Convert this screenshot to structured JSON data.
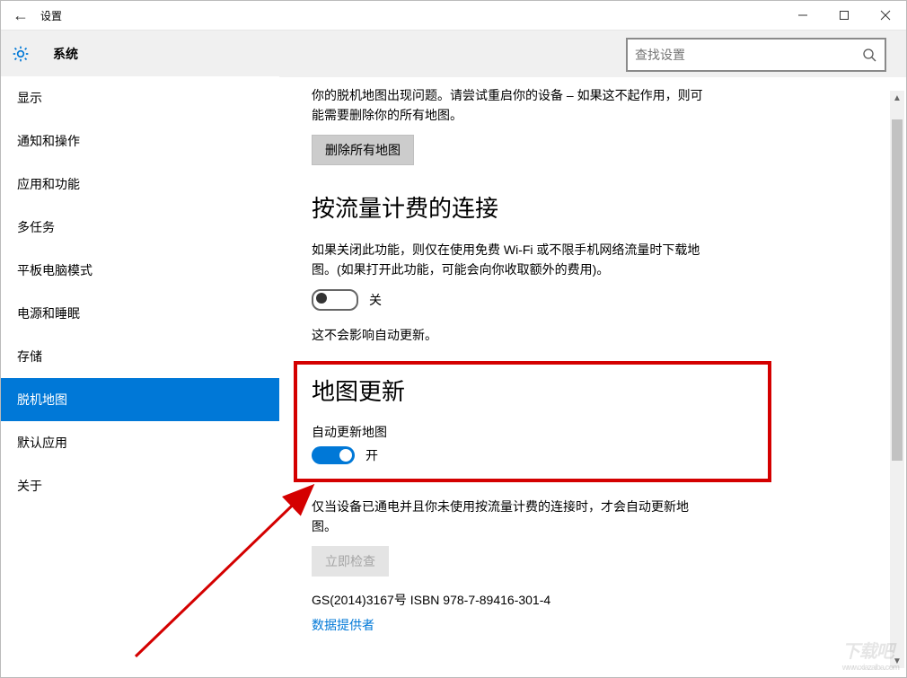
{
  "window": {
    "title": "设置"
  },
  "header": {
    "title": "系统",
    "search_placeholder": "查找设置"
  },
  "sidebar": {
    "items": [
      {
        "label": "显示"
      },
      {
        "label": "通知和操作"
      },
      {
        "label": "应用和功能"
      },
      {
        "label": "多任务"
      },
      {
        "label": "平板电脑模式"
      },
      {
        "label": "电源和睡眠"
      },
      {
        "label": "存储"
      },
      {
        "label": "脱机地图"
      },
      {
        "label": "默认应用"
      },
      {
        "label": "关于"
      }
    ],
    "selected_index": 7
  },
  "content": {
    "offline_problem": "你的脱机地图出现问题。请尝试重启你的设备 – 如果这不起作用，则可能需要删除你的所有地图。",
    "delete_all_maps": "删除所有地图",
    "metered_heading": "按流量计费的连接",
    "metered_desc": "如果关闭此功能，则仅在使用免费 Wi-Fi 或不限手机网络流量时下载地图。(如果打开此功能，可能会向你收取额外的费用)。",
    "metered_toggle_state": "关",
    "metered_toggle_on": false,
    "metered_note": "这不会影响自动更新。",
    "update_heading": "地图更新",
    "auto_update_label": "自动更新地图",
    "auto_update_state": "开",
    "auto_update_on": true,
    "update_note": "仅当设备已通电并且你未使用按流量计费的连接时，才会自动更新地图。",
    "check_now": "立即检查",
    "legal": "GS(2014)3167号 ISBN 978-7-89416-301-4",
    "data_provider": "数据提供者"
  },
  "watermark": {
    "text": "下载吧",
    "url": "www.xiazaiba.com"
  }
}
